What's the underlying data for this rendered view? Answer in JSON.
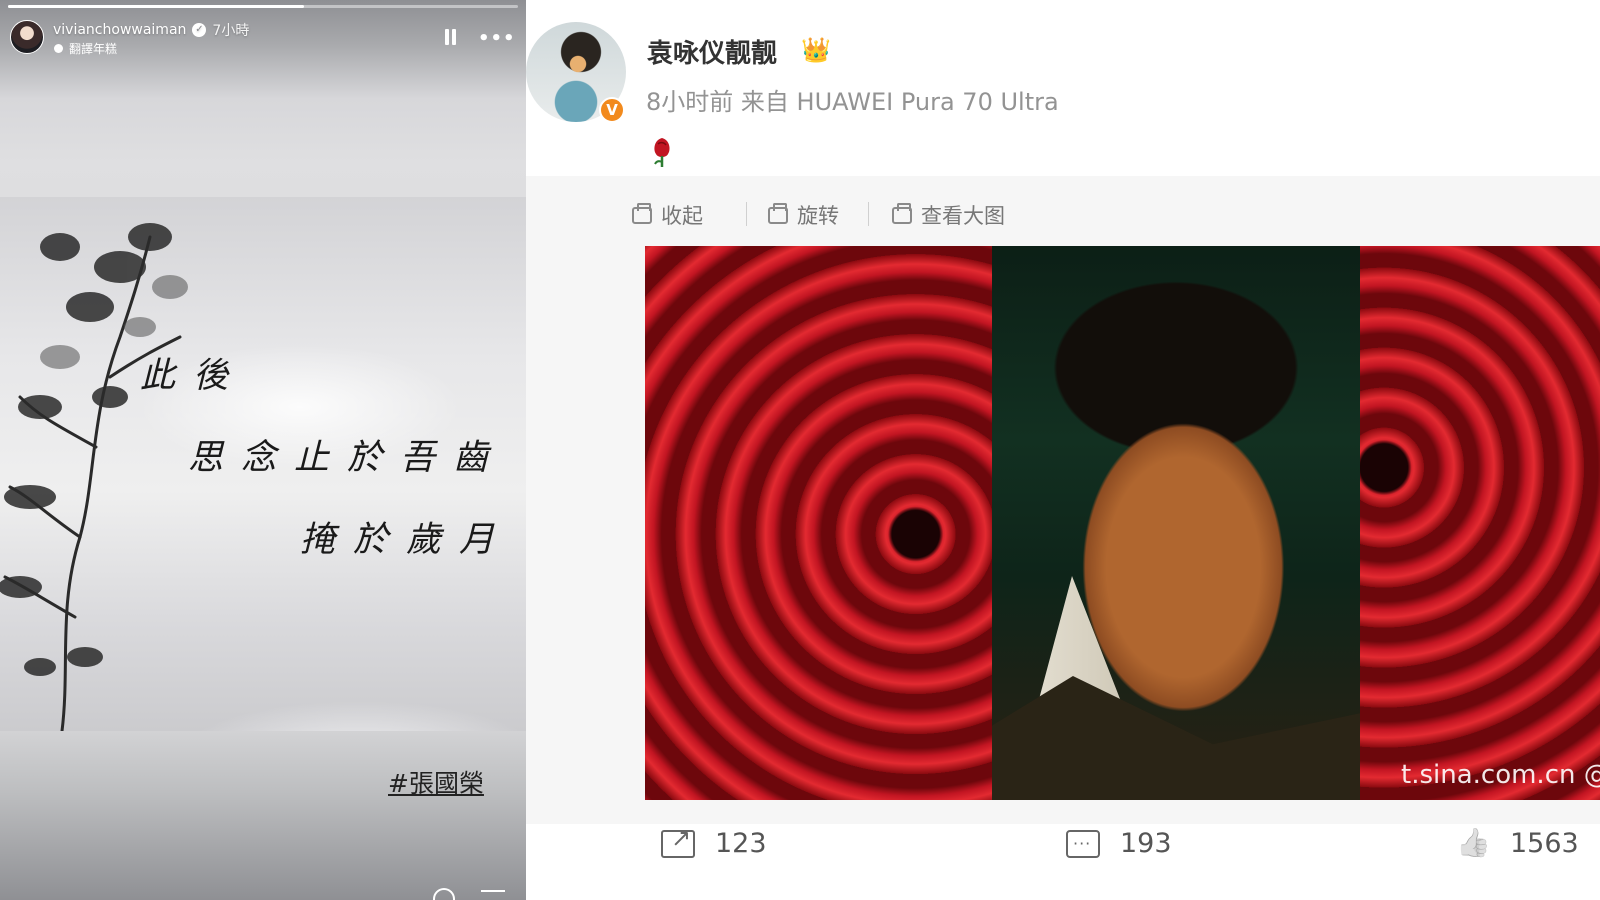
{
  "story": {
    "username": "vivianchowwaiman",
    "time": "7小時",
    "subtitle": "翻譯年糕",
    "progress": 0.58,
    "poem": [
      "此後",
      "思念止於吾齒",
      "掩於歲月"
    ],
    "hashtag": "#張國榮",
    "icons": [
      "verified-icon",
      "pause-icon",
      "more-icon",
      "heart-icon",
      "send-icon"
    ]
  },
  "weibo": {
    "name": "袁咏仪靓靓",
    "crown": "👑",
    "meta": "8小时前  来自 HUAWEI Pura 70 Ultra",
    "verified_badge": "V",
    "toolbar": {
      "collapse": "收起",
      "rotate": "旋转",
      "view_large": "查看大图"
    },
    "watermark": "t.sina.com.cn @袁咏",
    "actions": {
      "share_count": "123",
      "comment_count": "193",
      "like_count": "1563"
    },
    "colors": {
      "verified": "#f28a1d",
      "rose": "#c21522"
    }
  }
}
